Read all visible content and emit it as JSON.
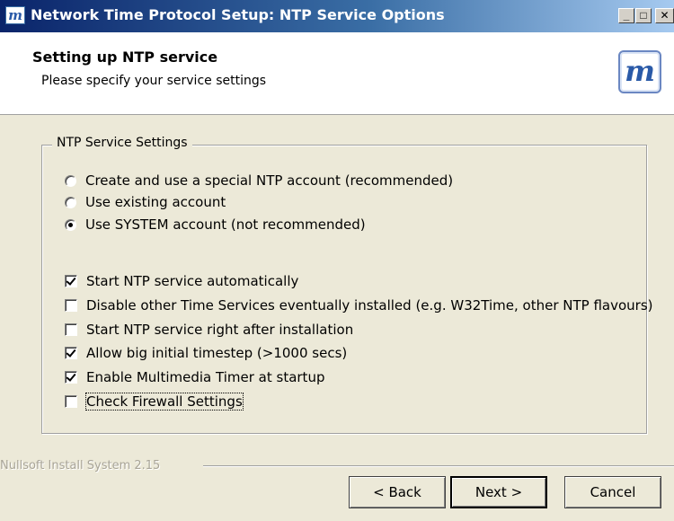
{
  "window": {
    "title": "Network Time Protocol Setup: NTP Service Options",
    "app_icon": "m-logo-icon",
    "controls": [
      "minimize-icon",
      "maximize-icon",
      "close-icon"
    ]
  },
  "header": {
    "title": "Setting up NTP service",
    "subtitle": "Please specify your service settings",
    "logo": "m-logo-icon"
  },
  "group": {
    "legend": "NTP Service Settings",
    "radios": [
      {
        "label": "Create and use a special NTP account  (recommended)",
        "selected": false
      },
      {
        "label": "Use existing account",
        "selected": false
      },
      {
        "label": "Use SYSTEM account (not recommended)",
        "selected": true
      }
    ],
    "checkboxes": [
      {
        "label": "Start NTP service automatically",
        "checked": true
      },
      {
        "label": "Disable other Time Services eventually installed (e.g. W32Time, other NTP flavours)",
        "checked": false
      },
      {
        "label": "Start NTP service right after installation",
        "checked": false
      },
      {
        "label": "Allow big initial timestep (>1000 secs)",
        "checked": true
      },
      {
        "label": "Enable Multimedia Timer at startup",
        "checked": true
      },
      {
        "label": "Check Firewall Settings",
        "checked": false,
        "focused": true
      }
    ]
  },
  "footer": {
    "brand": "Nullsoft Install System 2.15",
    "back_label": "< Back",
    "next_label": "Next >",
    "cancel_label": "Cancel"
  }
}
